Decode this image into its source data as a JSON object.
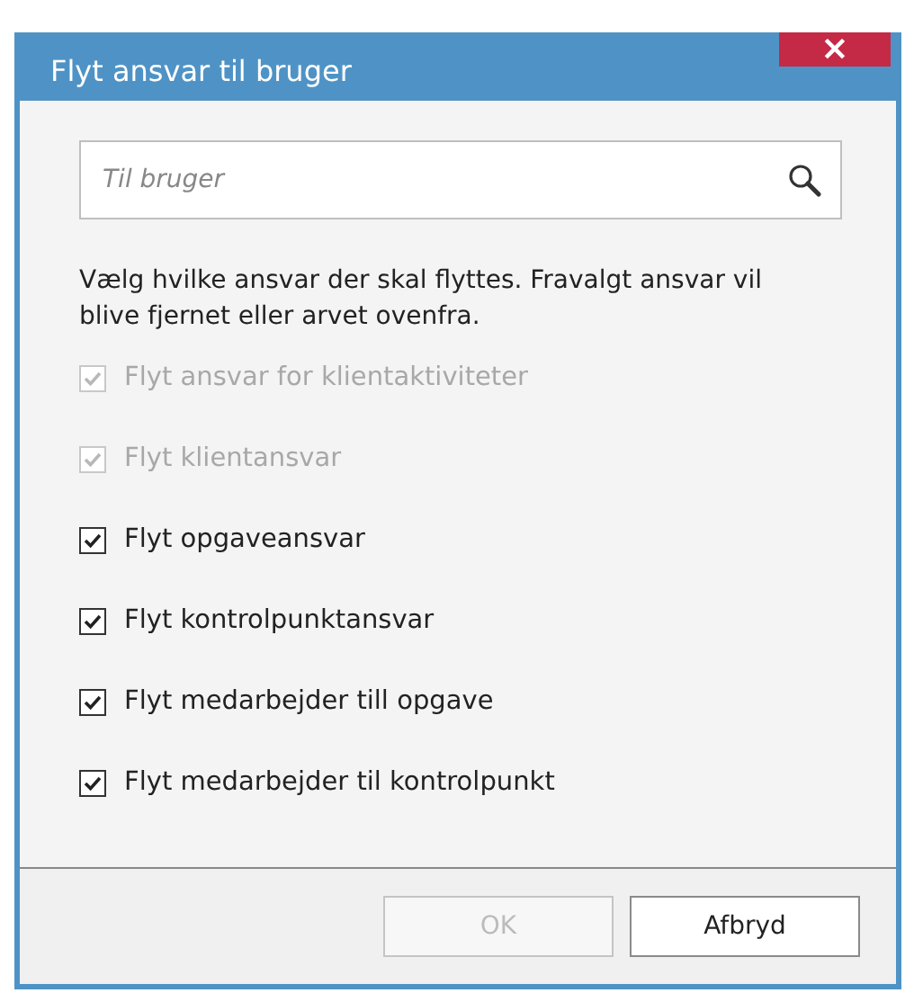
{
  "window": {
    "title": "Flyt ansvar til bruger",
    "close": "×"
  },
  "search": {
    "placeholder": "Til bruger"
  },
  "description": "Vælg hvilke ansvar der skal flyttes. Fravalgt ansvar vil blive fjernet eller arvet ovenfra.",
  "options": [
    {
      "label": "Flyt ansvar for klientaktiviteter",
      "checked": true,
      "disabled": true
    },
    {
      "label": "Flyt klientansvar",
      "checked": true,
      "disabled": true
    },
    {
      "label": "Flyt opgaveansvar",
      "checked": true,
      "disabled": false
    },
    {
      "label": "Flyt kontrolpunktansvar",
      "checked": true,
      "disabled": false
    },
    {
      "label": "Flyt medarbejder till opgave",
      "checked": true,
      "disabled": false
    },
    {
      "label": "Flyt medarbejder til kontrolpunkt",
      "checked": true,
      "disabled": false
    }
  ],
  "buttons": [
    {
      "label": "OK",
      "disabled": true
    },
    {
      "label": "Afbryd",
      "disabled": false
    }
  ]
}
